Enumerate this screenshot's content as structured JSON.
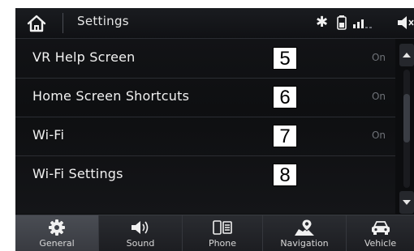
{
  "header": {
    "title": "Settings"
  },
  "status": {
    "bluetooth_icon": "bluetooth-icon",
    "battery_icon": "battery-icon",
    "signal_icon": "signal-icon",
    "volume_icon": "volume-icon"
  },
  "list": {
    "items": [
      {
        "label": "VR Help Screen",
        "value": "On",
        "callout": "5"
      },
      {
        "label": "Home Screen Shortcuts",
        "value": "On",
        "callout": "6"
      },
      {
        "label": "Wi-Fi",
        "value": "On",
        "callout": "7"
      },
      {
        "label": "Wi-Fi Settings",
        "value": "",
        "callout": "8"
      }
    ]
  },
  "tabs": [
    {
      "label": "General",
      "icon": "gear-icon",
      "active": true
    },
    {
      "label": "Sound",
      "icon": "speaker-icon",
      "active": false
    },
    {
      "label": "Phone",
      "icon": "phone-icon",
      "active": false
    },
    {
      "label": "Navigation",
      "icon": "map-pin-icon",
      "active": false
    },
    {
      "label": "Vehicle",
      "icon": "car-icon",
      "active": false
    }
  ],
  "colors": {
    "screen_bg": "#0c0d0f",
    "text": "#f2f2f2",
    "value_text": "#6f7278",
    "active_tab": "#4a4d54"
  }
}
